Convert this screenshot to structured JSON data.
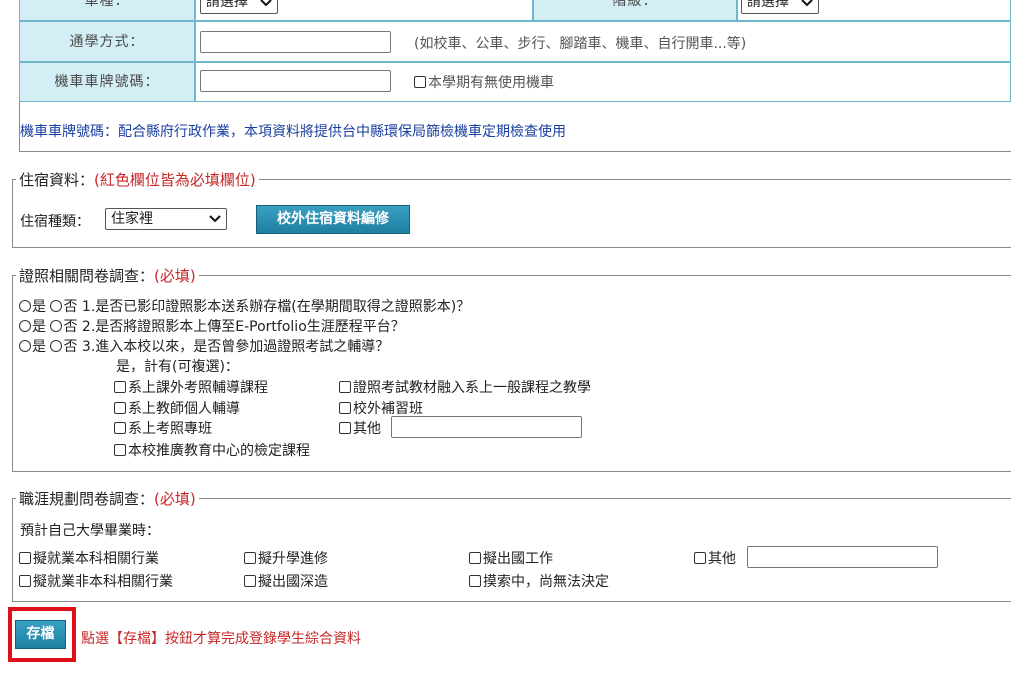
{
  "vehicle_table": {
    "row0": {
      "label_left": "車種：",
      "select_left": "請選擇",
      "label_right": "階級：",
      "select_right": "請選擇"
    },
    "commute": {
      "label": "通學方式：",
      "value": "",
      "hint": "(如校車、公車、步行、腳踏車、機車、自行開車...等)"
    },
    "plate": {
      "label": "機車車牌號碼：",
      "value": "",
      "no_motorcycle_label": "本學期有無使用機車"
    },
    "note": "機車車牌號碼：配合縣府行政作業，本項資料將提供台中縣環保局篩檢機車定期檢查使用"
  },
  "lodging": {
    "legend": "住宿資料：",
    "legend_req": "(紅色欄位皆為必填欄位)",
    "type_label": "住宿種類：",
    "type_value": "住家裡",
    "edit_button": "校外住宿資料編修"
  },
  "license_survey": {
    "legend": "證照相關問卷調查：",
    "legend_req": "(必填)",
    "yes": "是",
    "no": "否",
    "questions": [
      "1.是否已影印證照影本送系辦存檔(在學期間取得之證照影本)？",
      "2.是否將證照影本上傳至E-Portfolio生涯歷程平台？",
      "3.進入本校以來，是否曾參加過證照考試之輔導？"
    ],
    "sub_prompt": "是，計有(可複選)：",
    "options": [
      "系上課外考照輔導課程",
      "證照考試教材融入系上一般課程之教學",
      "系上教師個人輔導",
      "校外補習班",
      "系上考照專班",
      "其他",
      "本校推廣教育中心的檢定課程"
    ],
    "other_value": ""
  },
  "career_survey": {
    "legend": "職涯規劃問卷調查：",
    "legend_req": "(必填)",
    "prompt": "預計自己大學畢業時：",
    "options": [
      "擬就業本科相關行業",
      "擬升學進修",
      "擬出國工作",
      "其他",
      "擬就業非本科相關行業",
      "擬出國深造",
      "摸索中，尚無法決定"
    ],
    "other_value": ""
  },
  "footer": {
    "save_button": "存檔",
    "save_note": "點選【存檔】按鈕才算完成登錄學生綜合資料"
  },
  "colors": {
    "label_bg": "#d4eef5",
    "accent_red": "#c62828",
    "note_blue": "#1a3fa0",
    "button_teal": "#1f7fa3"
  }
}
